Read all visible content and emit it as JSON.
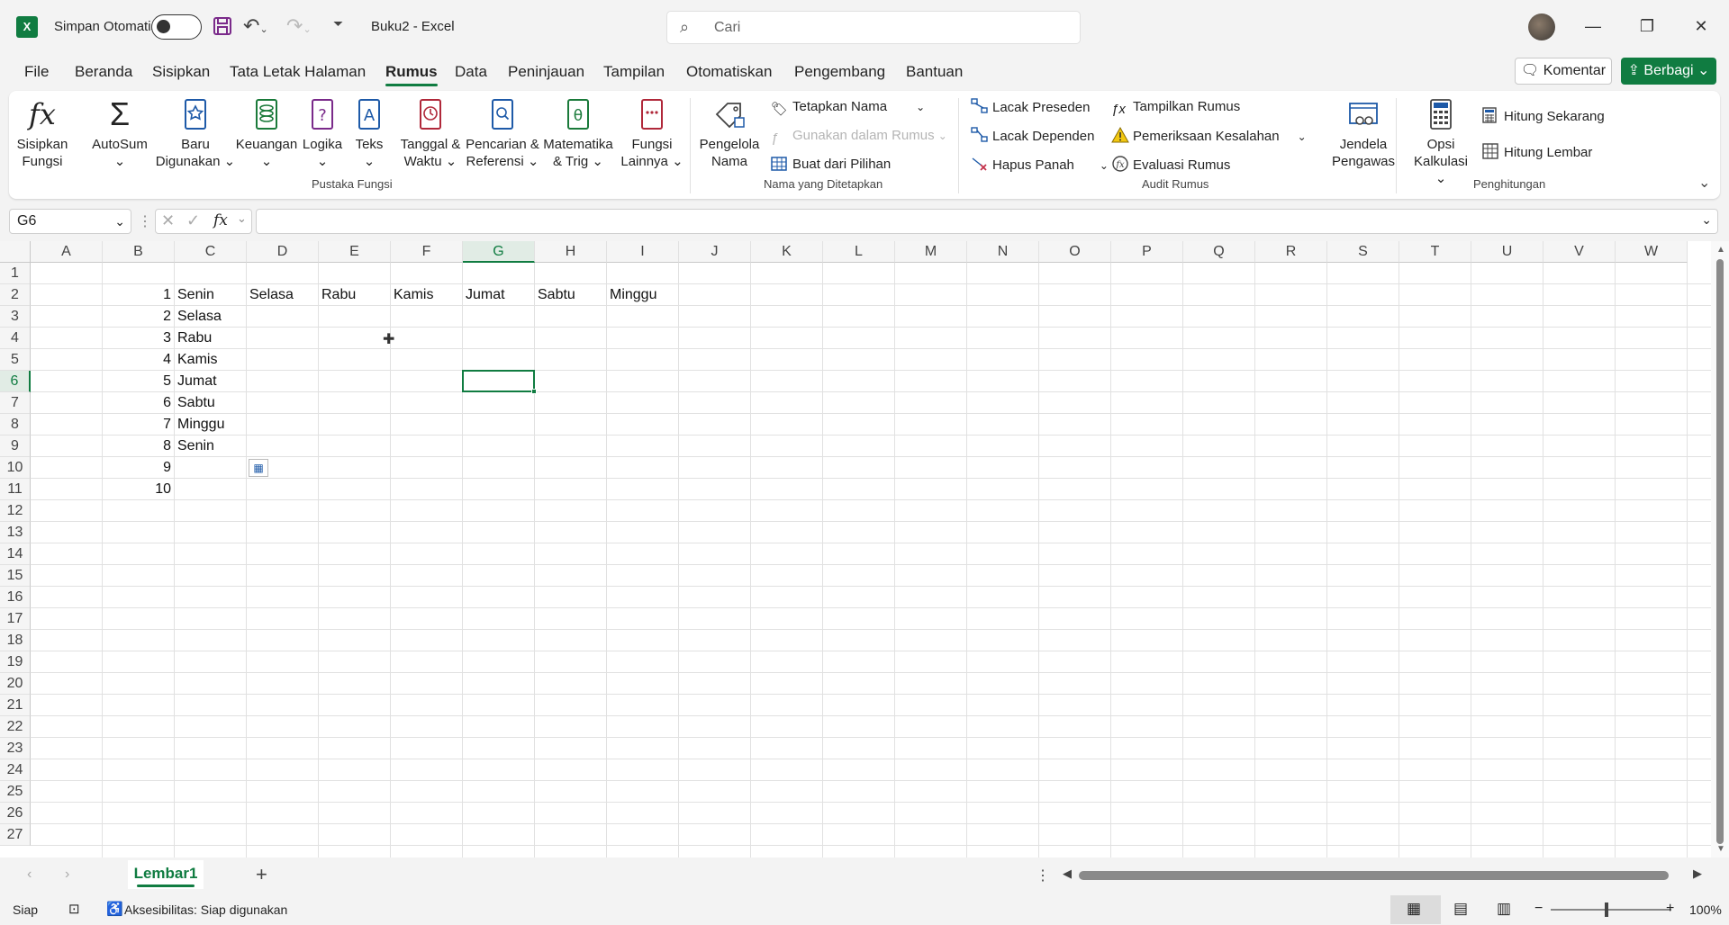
{
  "titlebar": {
    "app_logo": "X",
    "autosave_label": "Simpan Otomatis",
    "doc_title": "Buku2  -  Excel",
    "search_placeholder": "Cari"
  },
  "tabs": [
    "File",
    "Beranda",
    "Sisipkan",
    "Tata Letak Halaman",
    "Rumus",
    "Data",
    "Peninjauan",
    "Tampilan",
    "Otomatiskan",
    "Pengembang",
    "Bantuan"
  ],
  "active_tab": "Rumus",
  "buttons": {
    "comment": "Komentar",
    "share": "Berbagi"
  },
  "ribbon": {
    "function_library": {
      "label": "Pustaka Fungsi",
      "insert_function": [
        "Sisipkan",
        "Fungsi"
      ],
      "autosum": [
        "AutoSum",
        "⌄"
      ],
      "recent": [
        "Baru",
        "Digunakan ⌄"
      ],
      "financial": [
        "Keuangan",
        "⌄"
      ],
      "logical": [
        "Logika",
        "⌄"
      ],
      "text": [
        "Teks",
        "⌄"
      ],
      "datetime": [
        "Tanggal &",
        "Waktu ⌄"
      ],
      "lookup": [
        "Pencarian &",
        "Referensi ⌄"
      ],
      "math": [
        "Matematika",
        "& Trig ⌄"
      ],
      "more": [
        "Fungsi",
        "Lainnya ⌄"
      ]
    },
    "defined_names": {
      "label": "Nama yang Ditetapkan",
      "name_manager": [
        "Pengelola",
        "Nama"
      ],
      "define_name": "Tetapkan Nama",
      "use_in_formula": "Gunakan dalam Rumus",
      "create_from_selection": "Buat dari Pilihan"
    },
    "formula_auditing": {
      "label": "Audit Rumus",
      "trace_precedents": "Lacak Preseden",
      "trace_dependents": "Lacak Dependen",
      "remove_arrows": "Hapus Panah",
      "show_formulas": "Tampilkan Rumus",
      "error_checking": "Pemeriksaan Kesalahan",
      "evaluate_formula": "Evaluasi Rumus",
      "watch_window": [
        "Jendela",
        "Pengawas"
      ]
    },
    "calculation": {
      "label": "Penghitungan",
      "calc_options": [
        "Opsi",
        "Kalkulasi ⌄"
      ],
      "calc_now": "Hitung Sekarang",
      "calc_sheet": "Hitung Lembar"
    }
  },
  "formula_bar": {
    "name_box": "G6",
    "fx": "fx",
    "content": ""
  },
  "columns": [
    "A",
    "B",
    "C",
    "D",
    "E",
    "F",
    "G",
    "H",
    "I",
    "J",
    "K",
    "L",
    "M",
    "N",
    "O",
    "P",
    "Q",
    "R",
    "S",
    "T",
    "U",
    "V",
    "W"
  ],
  "selected_col": "G",
  "selected_row": 6,
  "rows": [
    "1",
    "2",
    "3",
    "4",
    "5",
    "6",
    "7",
    "8",
    "9",
    "10",
    "11",
    "12",
    "13",
    "14",
    "15",
    "16",
    "17",
    "18",
    "19",
    "20",
    "21",
    "22",
    "23",
    "24",
    "25",
    "26",
    "27"
  ],
  "cells": {
    "B2": "1",
    "B3": "2",
    "B4": "3",
    "B5": "4",
    "B6": "5",
    "B7": "6",
    "B8": "7",
    "B9": "8",
    "B10": "9",
    "B11": "10",
    "C2": "Senin",
    "C3": "Selasa",
    "C4": "Rabu",
    "C5": "Kamis",
    "C6": "Jumat",
    "C7": "Sabtu",
    "C8": "Minggu",
    "C9": "Senin",
    "D2": "Selasa",
    "E2": "Rabu",
    "F2": "Kamis",
    "G2": "Jumat",
    "H2": "Sabtu",
    "I2": "Minggu"
  },
  "sheet_tab": "Lembar1",
  "status": {
    "ready": "Siap",
    "accessibility": "Aksesibilitas: Siap digunakan",
    "zoom": "100%"
  }
}
